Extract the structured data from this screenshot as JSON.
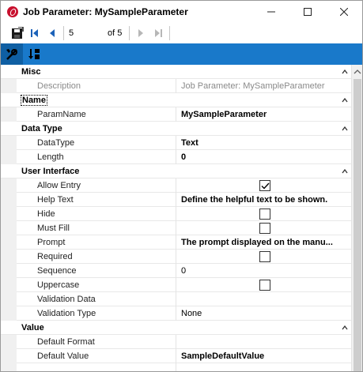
{
  "window": {
    "title": "Job Parameter: MySampleParameter",
    "controls": {
      "minimize": "—",
      "maximize": "☐",
      "close": "✕"
    }
  },
  "toolbar": {
    "record_value": "5",
    "record_count_label": "of 5"
  },
  "colors": {
    "accent": "#1979ca",
    "accent_active": "#0f5fa3"
  },
  "properties": {
    "misc": {
      "label": "Misc",
      "rows": [
        {
          "name": "Description",
          "value": "Job Parameter: MySampleParameter"
        }
      ]
    },
    "name": {
      "label": "Name",
      "rows": [
        {
          "name": "ParamName",
          "value": "MySampleParameter"
        }
      ]
    },
    "data_type": {
      "label": "Data Type",
      "rows": [
        {
          "name": "DataType",
          "value": "Text"
        },
        {
          "name": "Length",
          "value": "0"
        }
      ]
    },
    "user_interface": {
      "label": "User Interface",
      "rows": [
        {
          "name": "Allow Entry",
          "checked": true
        },
        {
          "name": "Help Text",
          "value": "Define the helpful text to be shown."
        },
        {
          "name": "Hide",
          "checked": false
        },
        {
          "name": "Must Fill",
          "checked": false
        },
        {
          "name": "Prompt",
          "value": "The prompt displayed on the manu..."
        },
        {
          "name": "Required",
          "checked": false
        },
        {
          "name": "Sequence",
          "value": "0"
        },
        {
          "name": "Uppercase",
          "checked": false
        },
        {
          "name": "Validation Data",
          "value": ""
        },
        {
          "name": "Validation Type",
          "value": "None"
        }
      ]
    },
    "value": {
      "label": "Value",
      "rows": [
        {
          "name": "Default Format",
          "value": ""
        },
        {
          "name": "Default Value",
          "value": "SampleDefaultValue"
        }
      ]
    }
  }
}
